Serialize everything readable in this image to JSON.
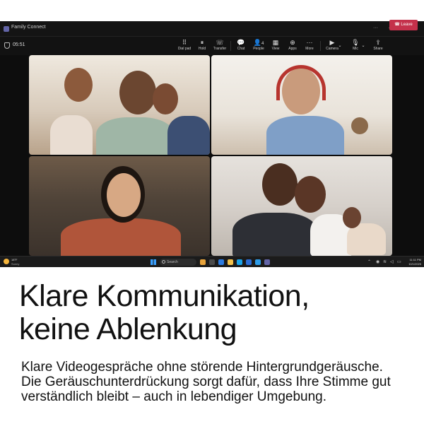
{
  "window": {
    "title": "Family Connect",
    "more_glyph": "···",
    "minimize_glyph": "–",
    "maximize_glyph": "□",
    "close_glyph": "✕"
  },
  "call": {
    "timer": "05:51",
    "toolbar": [
      {
        "label": "Dial pad",
        "icon": "dialpad-icon",
        "glyph": "⠿"
      },
      {
        "label": "Hold",
        "icon": "hold-icon",
        "glyph": "⏸"
      },
      {
        "label": "Transfer",
        "icon": "transfer-icon",
        "glyph": "☏"
      },
      {
        "label": "Chat",
        "icon": "chat-icon",
        "glyph": "💬"
      },
      {
        "label": "People",
        "icon": "people-icon",
        "glyph": "👤"
      },
      {
        "label": "View",
        "icon": "view-icon",
        "glyph": "▦"
      },
      {
        "label": "Apps",
        "icon": "apps-icon",
        "glyph": "⊕"
      },
      {
        "label": "More",
        "icon": "more-icon",
        "glyph": "···"
      },
      {
        "label": "Camera",
        "icon": "camera-icon",
        "glyph": "▶"
      },
      {
        "label": "Mic",
        "icon": "mic-icon",
        "glyph": "🎙"
      },
      {
        "label": "Share",
        "icon": "share-icon",
        "glyph": "⇪"
      }
    ],
    "people_count": "4",
    "leave_label": "Leave",
    "leave_color": "#c4314b"
  },
  "taskbar": {
    "weather_temp": "18°F",
    "weather_desc": "Sunny",
    "search_placeholder": "Search",
    "time": "11:11 PM",
    "date": "10/1/2025"
  },
  "marketing": {
    "headline_line1": "Klare Kommunikation,",
    "headline_line2": "keine Ablenkung",
    "body_line1": "Klare Videogespräche ohne störende Hintergrundgeräusche.",
    "body_line2": "Die Geräuschunterdrückung sorgt dafür, dass Ihre Stimme gut",
    "body_line3": "verständlich bleibt – auch in lebendiger Umgebung."
  }
}
